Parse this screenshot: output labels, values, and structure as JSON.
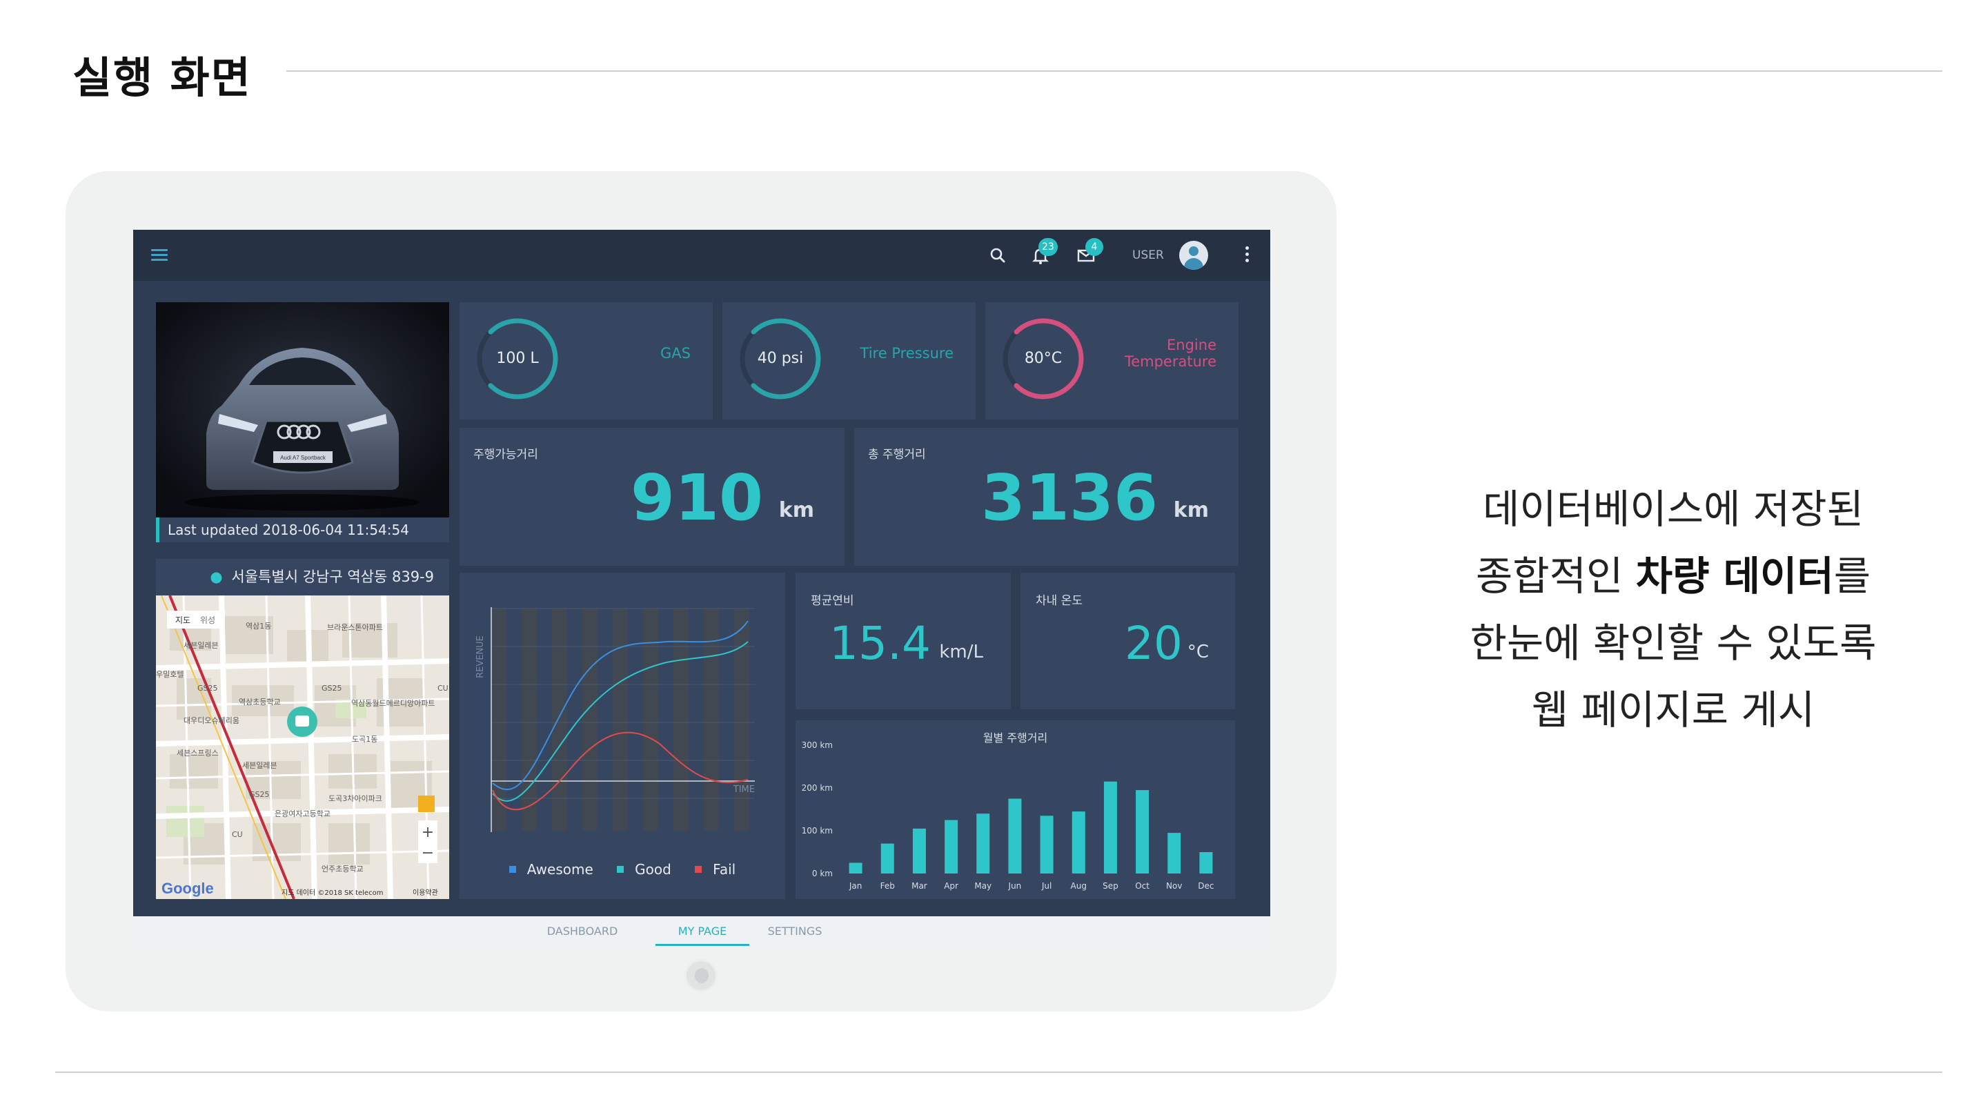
{
  "slide": {
    "title": "실행 화면",
    "description": {
      "line1": "데이터베이스에 저장된",
      "line2_pre": "종합적인 ",
      "line2_bold": "차량 데이터",
      "line2_post": "를",
      "line3": "한눈에 확인할 수 있도록",
      "line4": "웹 페이지로 게시"
    }
  },
  "topbar": {
    "user_label": "USER",
    "notification_count": "23",
    "message_count": "4",
    "icons": [
      "menu-icon",
      "search-icon",
      "bell-icon",
      "mail-icon",
      "avatar",
      "more-vertical-icon"
    ]
  },
  "car": {
    "last_updated_label": "Last updated",
    "last_updated_value": "2018-06-04 11:54:54",
    "plate_text": "Audi A7 Sportback"
  },
  "gauges": [
    {
      "value": "100 L",
      "label": "GAS",
      "label2": "",
      "fraction": 0.75,
      "color": "#2aa4a8"
    },
    {
      "value": "40 psi",
      "label": "Tire Pressure",
      "label2": "",
      "fraction": 0.75,
      "color": "#2aa4a8"
    },
    {
      "value": "80°C",
      "label": "Engine",
      "label2": "Temperature",
      "fraction": 0.75,
      "color": "#d4507e"
    }
  ],
  "distance": {
    "range_label": "주행가능거리",
    "range_value": "910",
    "range_unit": "km",
    "total_label": "총 주행거리",
    "total_value": "3136",
    "total_unit": "km"
  },
  "map": {
    "address": "서울특별시 강남구 역삼동 839-9",
    "tab_map": "지도",
    "tab_satellite": "위성",
    "labels": [
      "역삼1동",
      "브라운스톤아파트",
      "세븐일레븐",
      "GS25",
      "GS25",
      "역삼초등학교",
      "역삼동월드메르디앙아파트",
      "대우디오슈페리움",
      "세븐스프링스",
      "세븐일레븐",
      "GS25",
      "도곡3차아이파크",
      "은광여자고등학교",
      "CU",
      "언주초등학교",
      "도곡1동",
      "우밀호텔",
      "CU"
    ],
    "google": "Google",
    "copyright": "지도 데이터 ©2018 SK telecom",
    "terms": "이용약관",
    "zoom_in": "+",
    "zoom_out": "−"
  },
  "line_chart": {
    "ylabel": "REVENUE",
    "xlabel": "TIME",
    "legend": [
      {
        "name": "Awesome",
        "color": "#3b8fe0"
      },
      {
        "name": "Good",
        "color": "#2ec6c8"
      },
      {
        "name": "Fail",
        "color": "#e24b4b"
      }
    ]
  },
  "efficiency": {
    "label": "평균연비",
    "value": "15.4",
    "unit": "km/L"
  },
  "temperature": {
    "label": "차내 온도",
    "value": "20",
    "unit": "°C"
  },
  "chart_data": {
    "type": "bar",
    "title": "월별 주행거리",
    "categories": [
      "Jan",
      "Feb",
      "Mar",
      "Apr",
      "May",
      "Jun",
      "Jul",
      "Aug",
      "Sep",
      "Oct",
      "Nov",
      "Dec"
    ],
    "values": [
      25,
      70,
      105,
      125,
      140,
      175,
      135,
      145,
      215,
      195,
      95,
      50
    ],
    "ylim": [
      0,
      300
    ],
    "yticks": [
      "0 km",
      "100 km",
      "200 km",
      "300 km"
    ],
    "ytick_values": [
      0,
      100,
      200,
      300
    ],
    "color": "#2ec6c8"
  },
  "bottom_nav": {
    "tabs": [
      "DASHBOARD",
      "MY PAGE",
      "SETTINGS"
    ],
    "active": "MY PAGE"
  }
}
